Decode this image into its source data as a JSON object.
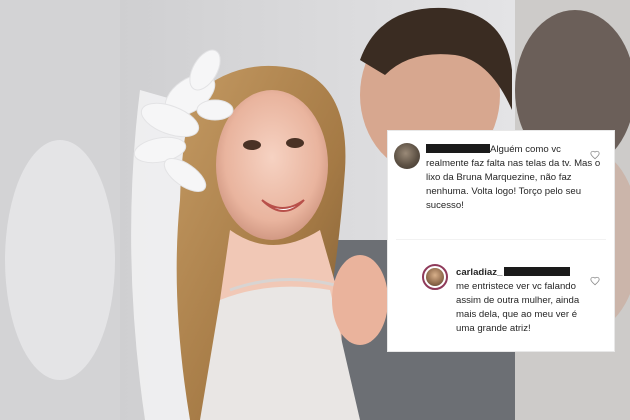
{
  "comments": [
    {
      "text": "Alguém como vc realmente faz falta nas telas da tv. Mas o lixo da Bruna Marquezine, não faz nenhuma. Volta logo! Torço pelo seu sucesso!"
    },
    {
      "username": "carladiaz_",
      "text": "me entristece ver vc falando assim de outra mulher, ainda mais dela, que ao meu ver é uma grande atriz!"
    }
  ]
}
